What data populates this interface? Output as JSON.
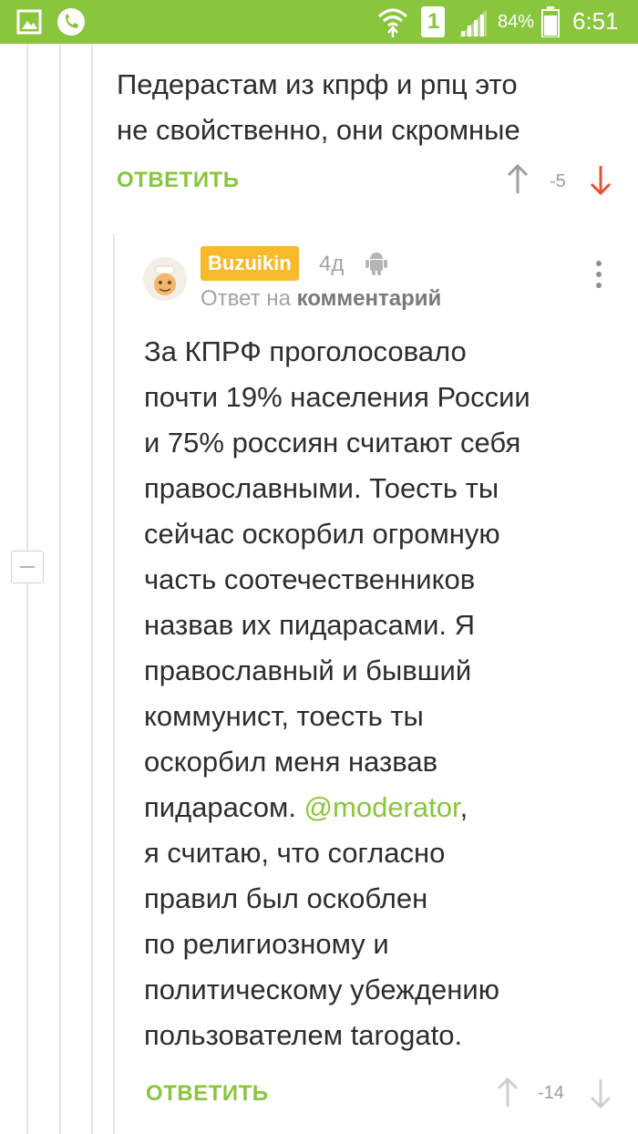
{
  "status_bar": {
    "battery_percent": "84%",
    "sim_slot": "1",
    "time": "6:51",
    "icons": [
      "image-icon",
      "phone-icon",
      "wifi-icon",
      "sim-icon",
      "signal-icon",
      "battery-icon"
    ]
  },
  "parent_comment": {
    "text_lines": [
      "Педерастам из кпрф и рпц это",
      "не свойственно, они скромные"
    ],
    "reply_label": "ОТВЕТИТЬ",
    "score": "-5"
  },
  "reply_comment": {
    "username": "Buzuikin",
    "time": "4д",
    "platform_icon": "android-icon",
    "reply_prefix": "Ответ на",
    "reply_target": "комментарий",
    "text_lines": [
      "За КПРФ проголосовало",
      "почти 19% населения России",
      "и 75% россиян считают себя",
      "православными. Тоесть ты",
      "сейчас оскорбил огромную",
      "часть соотечественников",
      "назвав их пидарасами. Я",
      "православный и бывший",
      "коммунист, тоесть ты",
      "оскорбил меня назвав"
    ],
    "mention_line_before": "пидарасом. ",
    "mention": "@moderator",
    "mention_line_after": ",",
    "text_lines_after": [
      "я считаю, что согласно",
      "правил был оскоблен",
      "по религиозному и",
      "политическому убеждению",
      "пользователем tarogato."
    ],
    "reply_label": "ОТВЕТИТЬ",
    "score": "-14"
  },
  "colors": {
    "accent": "#8ac53e",
    "downvote": "#e8503a",
    "badge": "#f8b92b"
  }
}
